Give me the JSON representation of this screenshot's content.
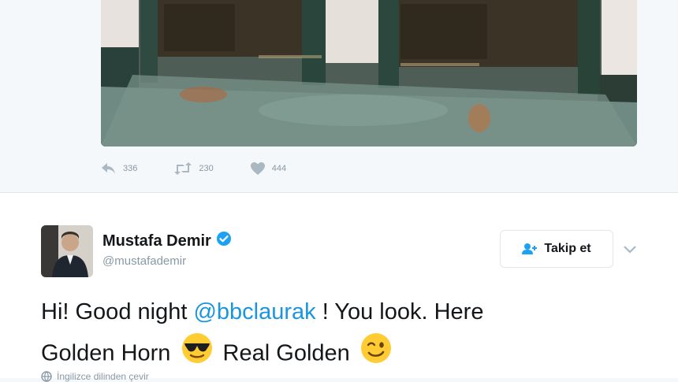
{
  "previous_tweet": {
    "actions": {
      "reply_count": "336",
      "retweet_count": "230",
      "like_count": "444"
    }
  },
  "tweet": {
    "display_name": "Mustafa Demir",
    "handle": "@mustafademir",
    "follow_label": "Takip et",
    "text_parts": {
      "line1_a": "Hi! Good night ",
      "mention": "@bbclaurak",
      "line1_b": " ! You look. Here",
      "line2_a": "Golden Horn ",
      "line2_b": " Real Golden "
    },
    "translate_label": "İngilizce dilinden çevir"
  },
  "colors": {
    "accent": "#1b95e0",
    "verified": "#1da1f2",
    "muted": "#8899a6"
  },
  "icons": [
    "reply-icon",
    "retweet-icon",
    "heart-icon",
    "verified-icon",
    "add-user-icon",
    "chevron-down-icon",
    "globe-icon",
    "sunglasses-emoji",
    "wink-emoji"
  ]
}
